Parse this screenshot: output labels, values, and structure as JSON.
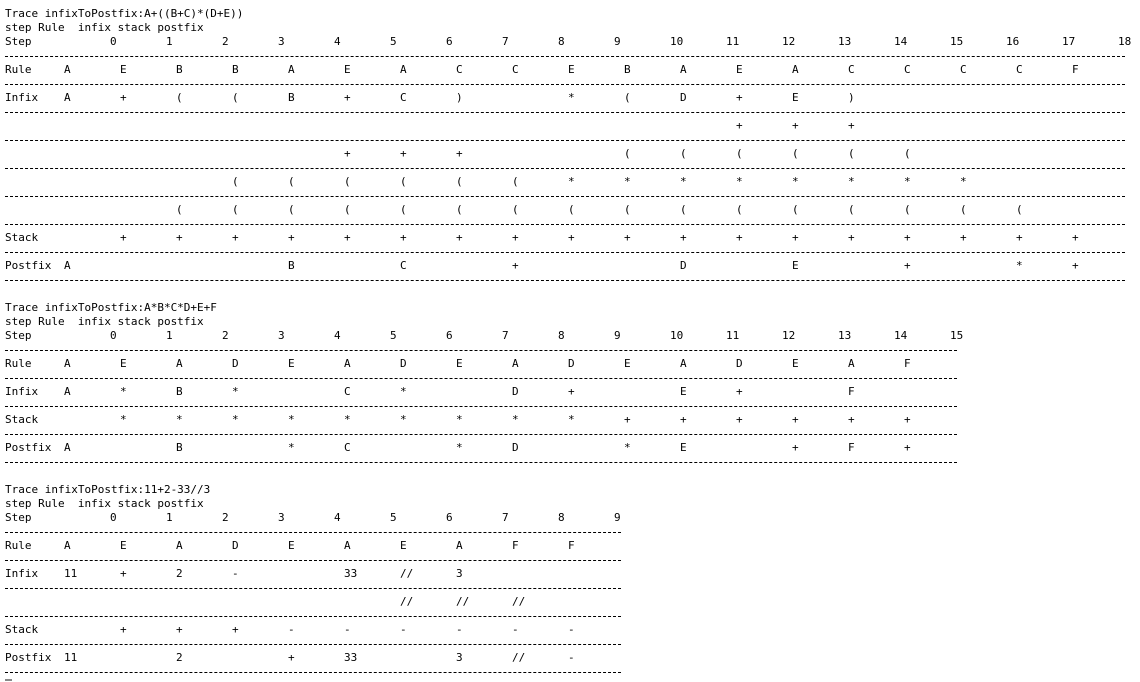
{
  "blocks": [
    {
      "title": "Trace infixToPostfix:A+((B+C)*(D+E))",
      "header": "step Rule  infix stack postfix",
      "step_label": "Step",
      "steps": [
        "0",
        "1",
        "2",
        "3",
        "4",
        "5",
        "6",
        "7",
        "8",
        "9",
        "10",
        "11",
        "12",
        "13",
        "14",
        "15",
        "16",
        "17",
        "18"
      ],
      "rows": [
        {
          "label": "Rule",
          "cells": [
            "A",
            "E",
            "B",
            "B",
            "A",
            "E",
            "A",
            "C",
            "C",
            "E",
            "B",
            "A",
            "E",
            "A",
            "C",
            "C",
            "C",
            "C",
            "F"
          ]
        },
        {
          "label": "Infix",
          "cells": [
            "A",
            "+",
            "(",
            "(",
            "B",
            "+",
            "C",
            ")",
            "",
            "*",
            "(",
            "D",
            "+",
            "E",
            ")",
            "",
            "",
            ""
          ]
        },
        {
          "label": "",
          "cells": [
            "",
            "",
            "",
            "",
            "",
            "",
            "",
            "",
            "",
            "",
            "",
            "",
            "+",
            "+",
            "+",
            "",
            "",
            "",
            ""
          ]
        },
        {
          "label": "",
          "cells": [
            "",
            "",
            "",
            "",
            "",
            "+",
            "+",
            "+",
            "",
            "",
            "(",
            "(",
            "(",
            "(",
            "(",
            "(",
            "",
            "",
            ""
          ]
        },
        {
          "label": "",
          "cells": [
            "",
            "",
            "",
            "(",
            "(",
            "(",
            "(",
            "(",
            "(",
            "*",
            "*",
            "*",
            "*",
            "*",
            "*",
            "*",
            "*",
            "",
            ""
          ]
        },
        {
          "label": "",
          "cells": [
            "",
            "",
            "(",
            "(",
            "(",
            "(",
            "(",
            "(",
            "(",
            "(",
            "(",
            "(",
            "(",
            "(",
            "(",
            "(",
            "(",
            "(",
            ""
          ]
        },
        {
          "label": "Stack",
          "cells": [
            "",
            "+",
            "+",
            "+",
            "+",
            "+",
            "+",
            "+",
            "+",
            "+",
            "+",
            "+",
            "+",
            "+",
            "+",
            "+",
            "+",
            "+",
            "+"
          ]
        },
        {
          "label": "Postfix",
          "cells": [
            "A",
            "",
            "",
            "",
            "B",
            "",
            "C",
            "",
            "+",
            "",
            "",
            "D",
            "",
            "E",
            "",
            "+",
            "",
            "*",
            "+"
          ]
        }
      ]
    },
    {
      "title": "Trace infixToPostfix:A*B*C*D+E+F",
      "header": "step Rule  infix stack postfix",
      "step_label": "Step",
      "steps": [
        "0",
        "1",
        "2",
        "3",
        "4",
        "5",
        "6",
        "7",
        "8",
        "9",
        "10",
        "11",
        "12",
        "13",
        "14",
        "15"
      ],
      "rows": [
        {
          "label": "Rule",
          "cells": [
            "A",
            "E",
            "A",
            "D",
            "E",
            "A",
            "D",
            "E",
            "A",
            "D",
            "E",
            "A",
            "D",
            "E",
            "A",
            "F"
          ]
        },
        {
          "label": "Infix",
          "cells": [
            "A",
            "*",
            "B",
            "*",
            "",
            "C",
            "*",
            "",
            "D",
            "+",
            "",
            "E",
            "+",
            "",
            "F",
            ""
          ]
        },
        {
          "label": "Stack",
          "cells": [
            "",
            "*",
            "*",
            "*",
            "*",
            "*",
            "*",
            "*",
            "*",
            "*",
            "+",
            "+",
            "+",
            "+",
            "+",
            "+"
          ]
        },
        {
          "label": "Postfix",
          "cells": [
            "A",
            "",
            "B",
            "",
            "*",
            "C",
            "",
            "*",
            "D",
            "",
            "*",
            "E",
            "",
            "+",
            "F",
            "+"
          ]
        }
      ]
    },
    {
      "title": "Trace infixToPostfix:11+2-33//3",
      "header": "step Rule  infix stack postfix",
      "step_label": "Step",
      "steps": [
        "0",
        "1",
        "2",
        "3",
        "4",
        "5",
        "6",
        "7",
        "8",
        "9"
      ],
      "rows": [
        {
          "label": "Rule",
          "cells": [
            "A",
            "E",
            "A",
            "D",
            "E",
            "A",
            "E",
            "A",
            "F",
            "F"
          ]
        },
        {
          "label": "Infix",
          "cells": [
            "11",
            "+",
            "2",
            "-",
            "",
            "33",
            "//",
            "3",
            "",
            ""
          ]
        },
        {
          "label": "",
          "cells": [
            "",
            "",
            "",
            "",
            "",
            "",
            "//",
            "//",
            "//",
            ""
          ]
        },
        {
          "label": "Stack",
          "cells": [
            "",
            "+",
            "+",
            "+",
            "-",
            "-",
            "-",
            "-",
            "-",
            "-"
          ]
        },
        {
          "label": "Postfix",
          "cells": [
            "11",
            "",
            "2",
            "",
            "+",
            "33",
            "",
            "3",
            "//",
            "-"
          ]
        }
      ]
    }
  ]
}
